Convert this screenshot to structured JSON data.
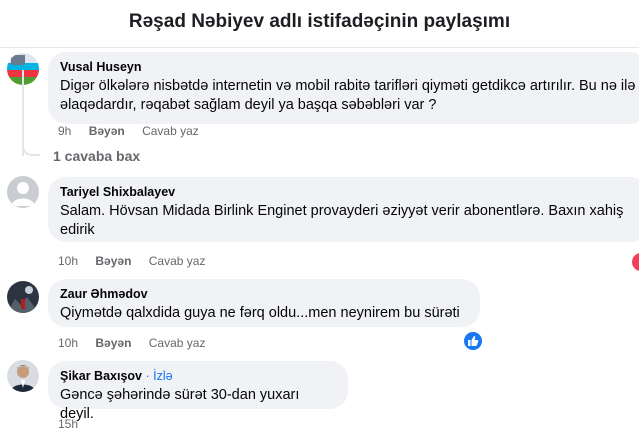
{
  "page": {
    "title": "Rəşad Nəbiyev adlı istifadəçinin paylaşımı"
  },
  "comments": [
    {
      "author": "Vusal Huseyn",
      "text": "Digər ölkələrə nisbətdə internetin və mobil rabitə tarifləri qiyməti getdikcə artırılır. Bu nə ilə əlaqədardır, rəqabət sağlam deyil ya başqa səbəbləri var ?",
      "time": "9h",
      "like_label": "Bəyən",
      "reply_label": "Cavab yaz"
    },
    {
      "author": "Tariyel Shixbalayev",
      "text": "Salam. Hövsan Midada Birlink Enginet provayderi əziyyət verir abonentlərə. Baxın xahiş edirik",
      "time": "10h",
      "like_label": "Bəyən",
      "reply_label": "Cavab yaz"
    },
    {
      "author": "Zaur Əhmədov",
      "text": "Qiymətdə qalxdida guya ne fərq oldu...men neynirem bu sürəti",
      "time": "10h",
      "like_label": "Bəyən",
      "reply_label": "Cavab yaz"
    },
    {
      "author": "Şikar Baxışov",
      "follow_label": "İzlə",
      "text": "Gəncə şəhərində sürət 30-dan yuxarı deyil.",
      "time": "15h"
    }
  ],
  "thread": {
    "replies_label": "1 cavaba bax"
  },
  "colors": {
    "accent": "#1877f2",
    "bubble": "#f0f2f5",
    "meta": "#65676b"
  }
}
